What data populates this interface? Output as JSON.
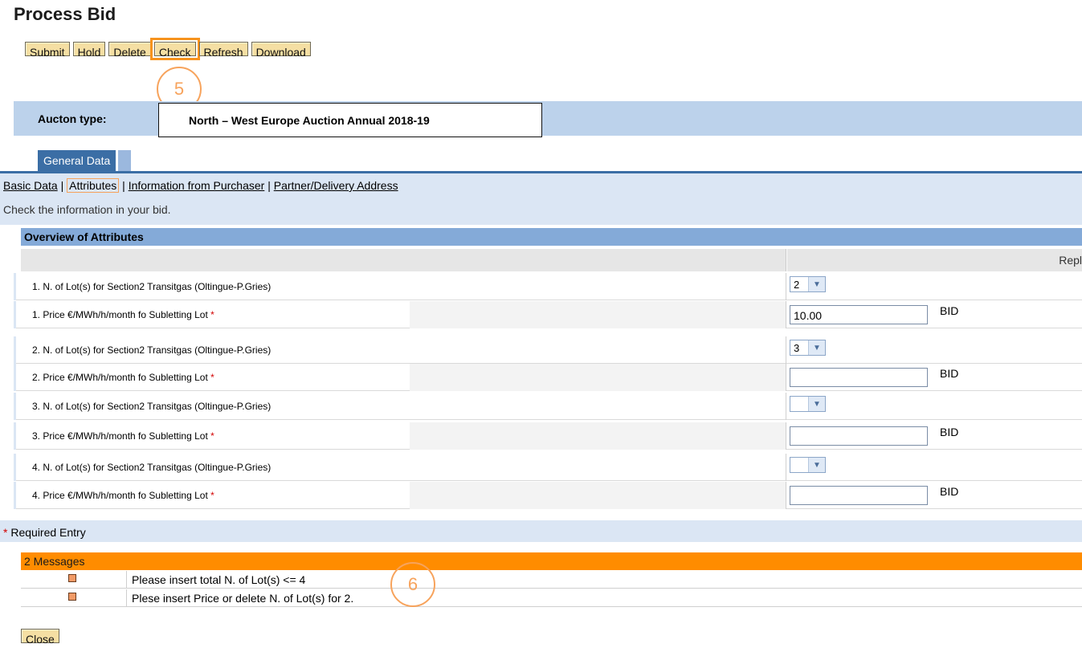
{
  "page": {
    "title": "Process Bid"
  },
  "toolbar": {
    "buttons": [
      "Submit",
      "Hold",
      "Delete",
      "Check",
      "Refresh",
      "Download"
    ]
  },
  "annotations": {
    "step5": "5",
    "step6": "6"
  },
  "auction": {
    "label": "Aucton type:",
    "value": "North – West Europe Auction Annual 2018-19"
  },
  "tabs": {
    "main": "General Data"
  },
  "subnav": {
    "basic": "Basic Data",
    "attributes": "Attributes",
    "info": "Information from Purchaser",
    "partner": "Partner/Delivery Address",
    "sep": "|"
  },
  "hint": "Check the information in your bid.",
  "overview": {
    "header": "Overview of Attributes",
    "col_right": "Repl"
  },
  "attributes": [
    {
      "label": "1. N. of Lot(s) for Section2 Transitgas (Oltingue-P.Gries)",
      "type": "select",
      "value": "2"
    },
    {
      "label": "1. Price €/MWh/h/month fo Subletting Lot",
      "type": "input",
      "value": "10.00",
      "suffix": "BID"
    },
    {
      "label": "2. N. of Lot(s) for Section2 Transitgas (Oltingue-P.Gries)",
      "type": "select",
      "value": "3"
    },
    {
      "label": "2. Price €/MWh/h/month fo Subletting Lot",
      "type": "input",
      "value": "",
      "suffix": "BID"
    },
    {
      "label": "3. N. of Lot(s) for Section2 Transitgas (Oltingue-P.Gries)",
      "type": "select",
      "value": ""
    },
    {
      "label": "3. Price €/MWh/h/month fo Subletting Lot",
      "type": "input",
      "value": "",
      "suffix": "BID"
    },
    {
      "label": "4. N. of Lot(s) for Section2 Transitgas (Oltingue-P.Gries)",
      "type": "select",
      "value": ""
    },
    {
      "label": "4. Price €/MWh/h/month fo Subletting Lot",
      "type": "input",
      "value": "",
      "suffix": "BID"
    }
  ],
  "required": {
    "star": "*",
    "text": "Required Entry"
  },
  "messages": {
    "header": "2 Messages",
    "items": [
      "Please insert total N. of Lot(s) <= 4",
      "Plese insert Price or delete N. of Lot(s) for 2."
    ]
  },
  "footer": {
    "close": "Close"
  },
  "colors": {
    "accent": "#f7931e",
    "tab": "#3b6ea5",
    "band": "#bcd2eb",
    "messages": "#ff8c00"
  }
}
